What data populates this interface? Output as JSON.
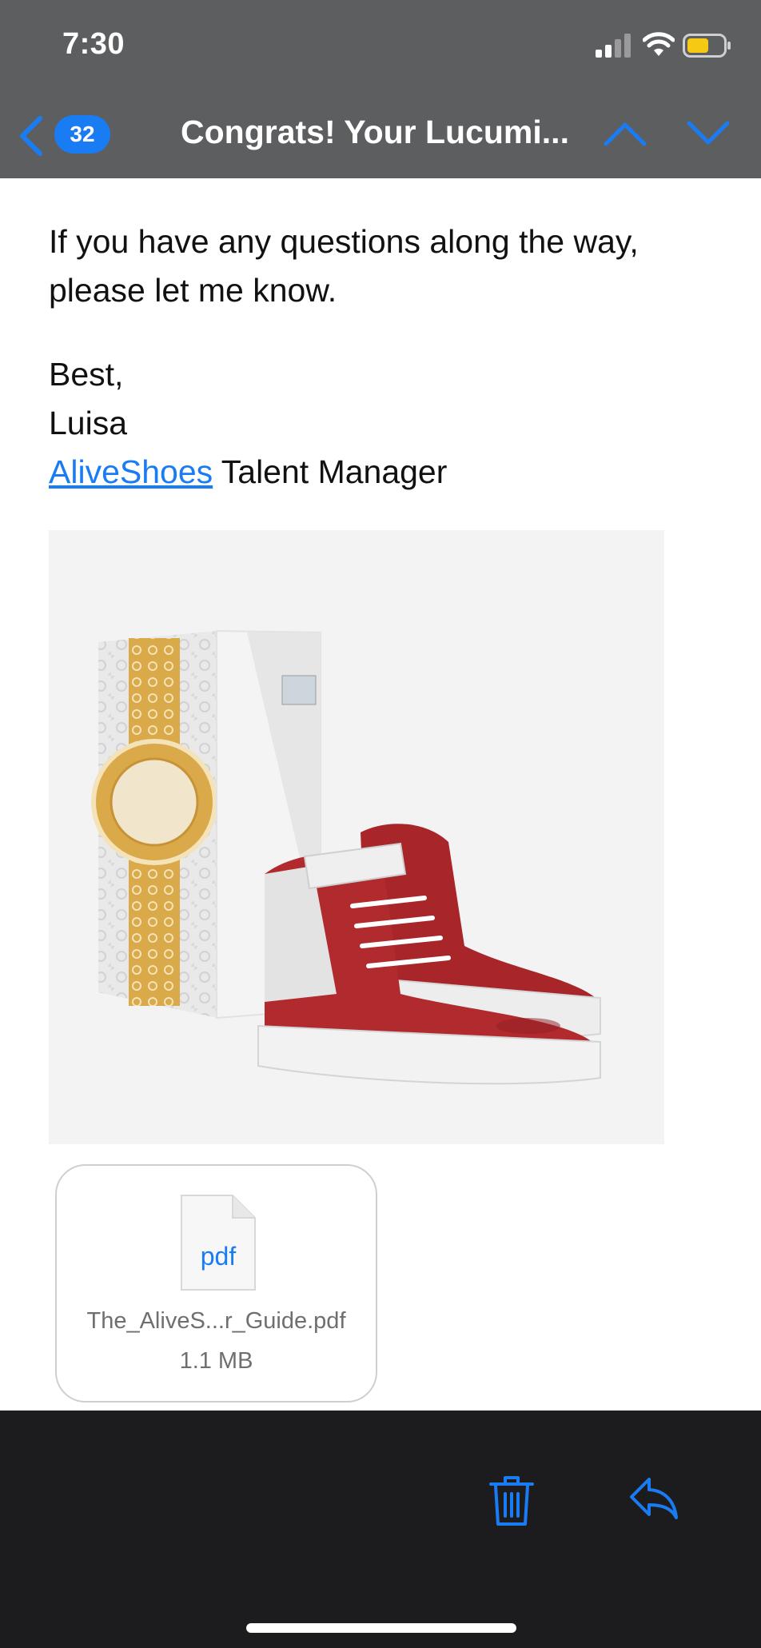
{
  "status_bar": {
    "time": "7:30"
  },
  "nav": {
    "unread_count": "32",
    "title": "Congrats! Your Lucumi..."
  },
  "message": {
    "paragraph": "If you have any questions along the way, please let me know.",
    "closing": "Best,",
    "sender_name": "Luisa",
    "signature_link": "AliveShoes",
    "signature_role": " Talent Manager"
  },
  "attachment": {
    "type_label": "pdf",
    "filename": "The_AliveS...r_Guide.pdf",
    "size": "1.1 MB"
  },
  "colors": {
    "accent": "#1a7cf2",
    "topbar": "#5d5e60",
    "toolbar": "#1c1c1e",
    "shoe_red": "#a8262a"
  }
}
